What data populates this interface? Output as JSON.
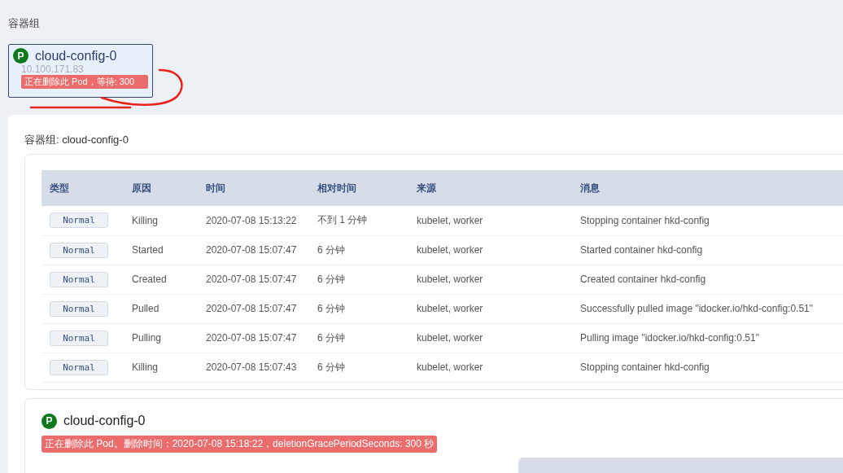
{
  "section_title": "容器组",
  "pod_card": {
    "name": "cloud-config-0",
    "phase_icon": "P",
    "ip": "10.100.171.83",
    "status_badge": "正在删除此 Pod，等待: 300"
  },
  "panel": {
    "title": "容器组: cloud-config-0",
    "events": {
      "columns": [
        "类型",
        "原因",
        "时间",
        "相对时间",
        "来源",
        "消息"
      ],
      "rows": [
        {
          "type": "Normal",
          "reason": "Killing",
          "time": "2020-07-08 15:13:22",
          "relative": "不到 1 分钟",
          "source": "kubelet, worker",
          "message": "Stopping container hkd-config"
        },
        {
          "type": "Normal",
          "reason": "Started",
          "time": "2020-07-08 15:07:47",
          "relative": "6 分钟",
          "source": "kubelet, worker",
          "message": "Started container hkd-config"
        },
        {
          "type": "Normal",
          "reason": "Created",
          "time": "2020-07-08 15:07:47",
          "relative": "6 分钟",
          "source": "kubelet, worker",
          "message": "Created container hkd-config"
        },
        {
          "type": "Normal",
          "reason": "Pulled",
          "time": "2020-07-08 15:07:47",
          "relative": "6 分钟",
          "source": "kubelet, worker",
          "message": "Successfully pulled image \"idocker.io/hkd-config:0.51\""
        },
        {
          "type": "Normal",
          "reason": "Pulling",
          "time": "2020-07-08 15:07:47",
          "relative": "6 分钟",
          "source": "kubelet, worker",
          "message": "Pulling image \"idocker.io/hkd-config:0.51\""
        },
        {
          "type": "Normal",
          "reason": "Killing",
          "time": "2020-07-08 15:07:43",
          "relative": "6 分钟",
          "source": "kubelet, worker",
          "message": "Stopping container hkd-config"
        }
      ]
    },
    "pod_detail": {
      "phase_icon": "P",
      "name": "cloud-config-0",
      "status_badge": "正在删除此 Pod。删除时间：2020-07-08 15:18:22，deletionGracePeriodSeconds: 300 秒"
    }
  }
}
